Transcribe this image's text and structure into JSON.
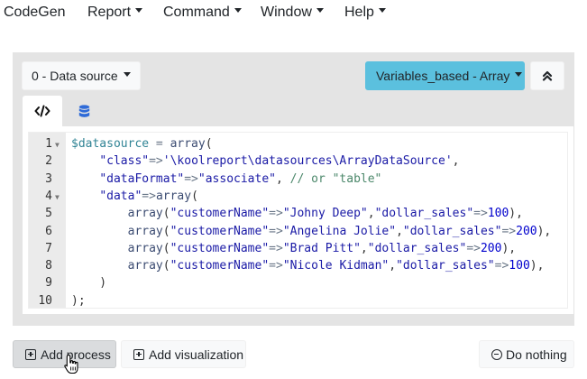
{
  "menubar": {
    "brand": "CodeGen",
    "menus": [
      {
        "label": "Report"
      },
      {
        "label": "Command"
      },
      {
        "label": "Window"
      },
      {
        "label": "Help"
      }
    ]
  },
  "panel": {
    "datasource_dropdown": "0 - Data source",
    "variables_dropdown": "Variables_based - Array",
    "tabs": [
      {
        "icon": "code-icon",
        "active": true
      },
      {
        "icon": "database-icon",
        "active": false
      }
    ]
  },
  "editor": {
    "lines": [
      {
        "n": "1",
        "fold": true,
        "tokens": [
          [
            "var",
            "$datasource"
          ],
          [
            "op",
            " = "
          ],
          [
            "fn",
            "array"
          ],
          [
            "p",
            "("
          ]
        ]
      },
      {
        "n": "2",
        "fold": false,
        "tokens": [
          [
            "p",
            "    "
          ],
          [
            "str",
            "\"class\""
          ],
          [
            "op",
            "=>"
          ],
          [
            "str",
            "'\\koolreport\\datasources\\ArrayDataSource'"
          ],
          [
            "p",
            ","
          ]
        ]
      },
      {
        "n": "3",
        "fold": false,
        "tokens": [
          [
            "p",
            "    "
          ],
          [
            "str",
            "\"dataFormat\""
          ],
          [
            "op",
            "=>"
          ],
          [
            "str",
            "\"associate\""
          ],
          [
            "p",
            ", "
          ],
          [
            "cm",
            "// or \"table\""
          ]
        ]
      },
      {
        "n": "4",
        "fold": true,
        "tokens": [
          [
            "p",
            "    "
          ],
          [
            "str",
            "\"data\""
          ],
          [
            "op",
            "=>"
          ],
          [
            "fn",
            "array"
          ],
          [
            "p",
            "("
          ]
        ]
      },
      {
        "n": "5",
        "fold": false,
        "tokens": [
          [
            "p",
            "        "
          ],
          [
            "fn",
            "array"
          ],
          [
            "p",
            "("
          ],
          [
            "str",
            "\"customerName\""
          ],
          [
            "op",
            "=>"
          ],
          [
            "str",
            "\"Johny Deep\""
          ],
          [
            "p",
            ","
          ],
          [
            "str",
            "\"dollar_sales\""
          ],
          [
            "op",
            "=>"
          ],
          [
            "num",
            "100"
          ],
          [
            "p",
            "),"
          ]
        ]
      },
      {
        "n": "6",
        "fold": false,
        "tokens": [
          [
            "p",
            "        "
          ],
          [
            "fn",
            "array"
          ],
          [
            "p",
            "("
          ],
          [
            "str",
            "\"customerName\""
          ],
          [
            "op",
            "=>"
          ],
          [
            "str",
            "\"Angelina Jolie\""
          ],
          [
            "p",
            ","
          ],
          [
            "str",
            "\"dollar_sales\""
          ],
          [
            "op",
            "=>"
          ],
          [
            "num",
            "200"
          ],
          [
            "p",
            "),"
          ]
        ]
      },
      {
        "n": "7",
        "fold": false,
        "tokens": [
          [
            "p",
            "        "
          ],
          [
            "fn",
            "array"
          ],
          [
            "p",
            "("
          ],
          [
            "str",
            "\"customerName\""
          ],
          [
            "op",
            "=>"
          ],
          [
            "str",
            "\"Brad Pitt\""
          ],
          [
            "p",
            ","
          ],
          [
            "str",
            "\"dollar_sales\""
          ],
          [
            "op",
            "=>"
          ],
          [
            "num",
            "200"
          ],
          [
            "p",
            "),"
          ]
        ]
      },
      {
        "n": "8",
        "fold": false,
        "tokens": [
          [
            "p",
            "        "
          ],
          [
            "fn",
            "array"
          ],
          [
            "p",
            "("
          ],
          [
            "str",
            "\"customerName\""
          ],
          [
            "op",
            "=>"
          ],
          [
            "str",
            "\"Nicole Kidman\""
          ],
          [
            "p",
            ","
          ],
          [
            "str",
            "\"dollar_sales\""
          ],
          [
            "op",
            "=>"
          ],
          [
            "num",
            "100"
          ],
          [
            "p",
            "),"
          ]
        ]
      },
      {
        "n": "9",
        "fold": false,
        "tokens": [
          [
            "p",
            "    )"
          ]
        ]
      },
      {
        "n": "10",
        "fold": false,
        "tokens": [
          [
            "p",
            ");"
          ]
        ]
      }
    ]
  },
  "actions": {
    "add_process": "Add process",
    "add_visualization": "Add visualization",
    "do_nothing": "Do nothing"
  },
  "colors": {
    "accent": "#5bc0de",
    "panel_bg": "#e4e4e4",
    "gutter_bg": "#ebebeb"
  }
}
